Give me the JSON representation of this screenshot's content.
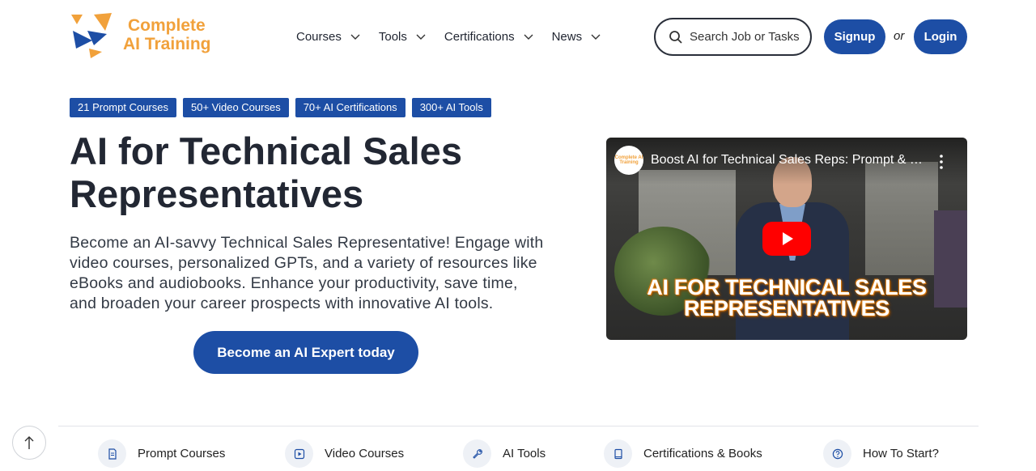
{
  "brand": {
    "line1": "Complete",
    "line2": "AI Training",
    "color": "#f1a13b",
    "accent": "#1d4ea5"
  },
  "nav": {
    "items": [
      {
        "label": "Courses"
      },
      {
        "label": "Tools"
      },
      {
        "label": "Certifications"
      },
      {
        "label": "News"
      }
    ]
  },
  "search": {
    "placeholder": "Search Job or Tasks"
  },
  "auth": {
    "signup": "Signup",
    "or": "or",
    "login": "Login"
  },
  "tags": [
    "21 Prompt Courses",
    "50+ Video Courses",
    "70+ AI Certifications",
    "300+ AI Tools"
  ],
  "hero": {
    "title_line1": "AI for Technical Sales",
    "title_line2": "Representatives",
    "description": "Become an AI-savvy Technical Sales Representative! Engage with video courses, personalized GPTs, and a variety of resources like eBooks and audiobooks. Enhance your productivity, save time, and broaden your career prospects with innovative AI tools.",
    "cta": "Become an AI Expert today"
  },
  "video": {
    "channel_badge": "Complete AI Training",
    "title": "Boost AI for Technical Sales Reps: Prompt & …",
    "overlay_line1": "AI FOR TECHNICAL SALES",
    "overlay_line2": "REPRESENTATIVES"
  },
  "bottom_nav": [
    {
      "label": "Prompt Courses",
      "icon": "document-icon"
    },
    {
      "label": "Video Courses",
      "icon": "play-square-icon"
    },
    {
      "label": "AI Tools",
      "icon": "wrench-icon"
    },
    {
      "label": "Certifications & Books",
      "icon": "book-icon"
    },
    {
      "label": "How To Start?",
      "icon": "question-icon"
    }
  ]
}
